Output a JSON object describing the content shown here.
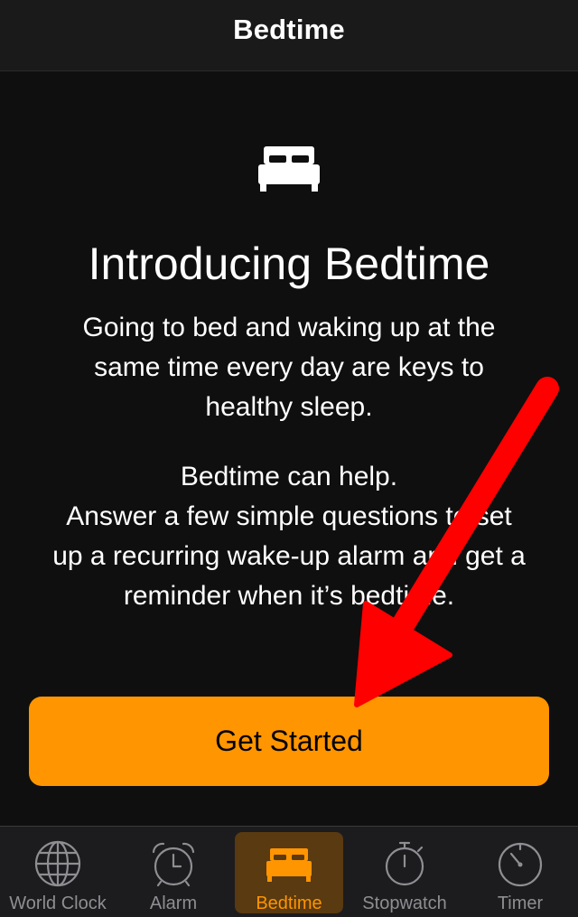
{
  "nav": {
    "title": "Bedtime"
  },
  "intro": {
    "icon": "bed-icon",
    "title": "Introducing Bedtime",
    "paragraph1": [
      "Going to bed and waking up at the",
      "same time every day are keys to",
      "healthy sleep."
    ],
    "paragraph2": [
      "Bedtime can help.",
      "Answer a few simple questions to set",
      "up a recurring wake-up alarm and get a",
      "reminder when it’s bedtime."
    ]
  },
  "cta": {
    "label": "Get Started"
  },
  "annotation": {
    "type": "red-arrow",
    "color": "#ff0000",
    "points_to": "get-started-button"
  },
  "tabs": [
    {
      "label": "World Clock",
      "icon": "globe-icon",
      "active": false
    },
    {
      "label": "Alarm",
      "icon": "alarm-clock-icon",
      "active": false
    },
    {
      "label": "Bedtime",
      "icon": "bed-icon",
      "active": true
    },
    {
      "label": "Stopwatch",
      "icon": "stopwatch-icon",
      "active": false
    },
    {
      "label": "Timer",
      "icon": "timer-icon",
      "active": false
    }
  ],
  "colors": {
    "accent": "#ff9500",
    "background": "#0f0f0f",
    "tab_inactive": "#8e8e93",
    "arrow": "#ff0000"
  }
}
